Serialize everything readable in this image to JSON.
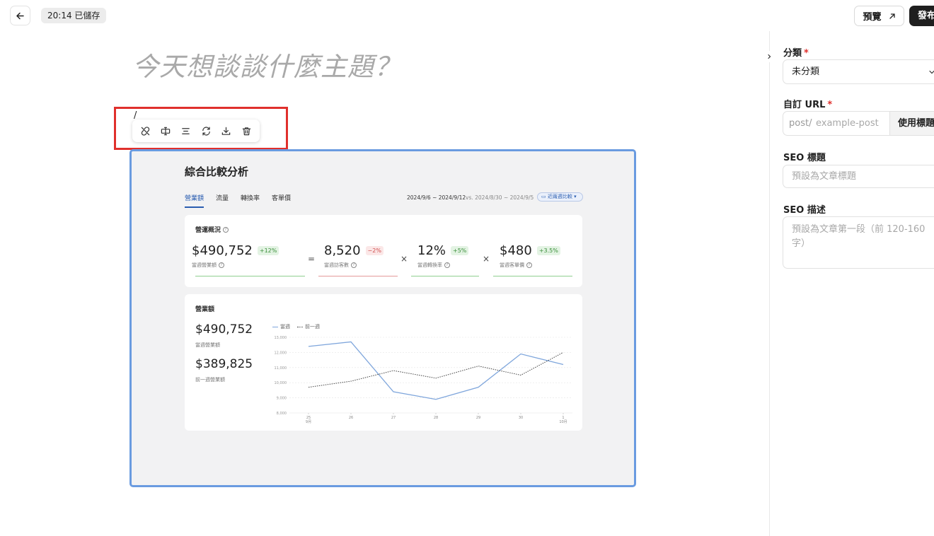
{
  "topbar": {
    "save_status": "20:14 已儲存",
    "preview_label": "預覽",
    "publish_label": "發布"
  },
  "editor": {
    "title_placeholder": "今天想談談什麼主題？",
    "slash_text": "/",
    "image_toolbar": [
      "unlink-icon",
      "text-width-icon",
      "align-center-icon",
      "replace-icon",
      "download-icon",
      "trash-icon"
    ]
  },
  "dashboard": {
    "title": "綜合比較分析",
    "tabs": [
      "營業額",
      "流量",
      "轉換率",
      "客單價"
    ],
    "active_tab": "營業額",
    "date_range": "2024/9/6 ~ 2024/9/12",
    "compare_range": "vs. 2024/8/30 ~ 2024/9/5",
    "compare_select": "近兩週比較",
    "overview": {
      "label": "營運概況",
      "metrics": [
        {
          "value": "$490,752",
          "delta": "+12%",
          "trend": "up",
          "label": "當週營業額",
          "line_color": "#8fcf8f"
        },
        {
          "value": "8,520",
          "delta": "−2%",
          "trend": "down",
          "label": "當週訪客數",
          "line_color": "#e59a9a"
        },
        {
          "value": "12%",
          "delta": "+5%",
          "trend": "up",
          "label": "當週轉換率",
          "line_color": "#8fcf8f"
        },
        {
          "value": "$480",
          "delta": "+3.5%",
          "trend": "up",
          "label": "當週客單價",
          "line_color": "#8fcf8f"
        }
      ],
      "operators": [
        "=",
        "×",
        "×"
      ]
    },
    "revenue": {
      "label": "營業額",
      "current_value": "$490,752",
      "current_label": "當週營業額",
      "previous_value": "$389,825",
      "previous_label": "前一週營業額"
    }
  },
  "chart_data": {
    "type": "line",
    "x": [
      "25",
      "26",
      "27",
      "28",
      "29",
      "30",
      "1"
    ],
    "x_month_labels": {
      "25": "9月",
      "1": "10月"
    },
    "series": [
      {
        "name": "當週",
        "values": [
          12400,
          12700,
          9400,
          8900,
          9700,
          11900,
          11200
        ],
        "color": "#7fa6dc",
        "style": "solid"
      },
      {
        "name": "前一週",
        "values": [
          9700,
          10100,
          10800,
          10300,
          11100,
          10500,
          12000
        ],
        "color": "#444444",
        "style": "dotted"
      }
    ],
    "y_ticks": [
      13000,
      12000,
      11000,
      10000,
      9000,
      8000
    ],
    "ylim": [
      8000,
      13000
    ],
    "grid": true,
    "legend": "top-left"
  },
  "sidebar": {
    "category_label": "分類",
    "category_value": "未分類",
    "url_label": "自訂 URL",
    "url_prefix": "post/",
    "url_placeholder": "example-post",
    "use_title_label": "使用標題",
    "seo_title_label": "SEO 標題",
    "seo_title_placeholder": "預設為文章標題",
    "seo_desc_label": "SEO 描述",
    "seo_desc_placeholder": "預設為文章第一段（前 120-160 字）",
    "required_mark": "*"
  }
}
